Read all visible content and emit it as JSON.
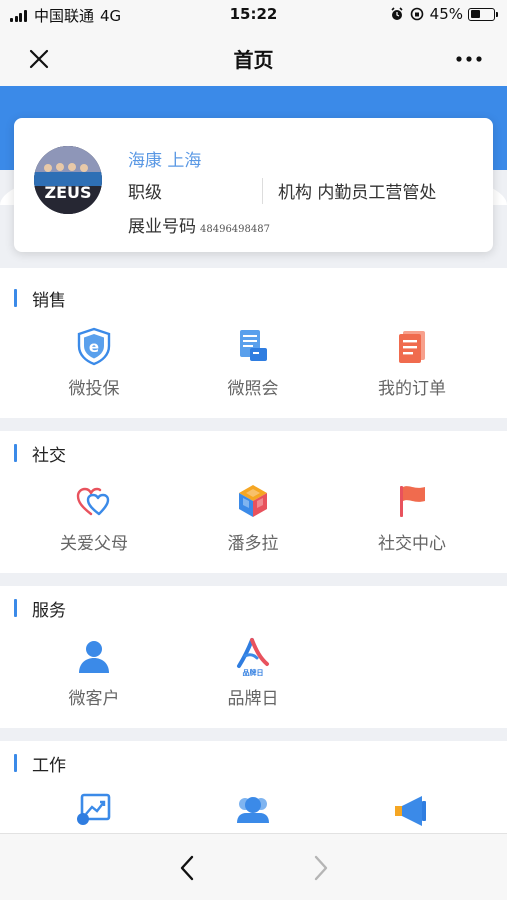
{
  "status_bar": {
    "carrier": "中国联通",
    "network": "4G",
    "time": "15:22",
    "battery": "45%",
    "battery_level": 0.45
  },
  "nav": {
    "title": "首页"
  },
  "profile": {
    "name_region": "海康 上海",
    "rank_label": "职级",
    "org": "机构 内勤员工营管处",
    "id_label": "展业号码",
    "id_number": "48496498487",
    "avatar_text": "ZEUS"
  },
  "sections": [
    {
      "title": "销售",
      "items": [
        {
          "label": "微投保",
          "icon": "shield-e-icon"
        },
        {
          "label": "微照会",
          "icon": "document-card-icon"
        },
        {
          "label": "我的订单",
          "icon": "order-list-icon"
        }
      ]
    },
    {
      "title": "社交",
      "items": [
        {
          "label": "关爱父母",
          "icon": "hearts-icon"
        },
        {
          "label": "潘多拉",
          "icon": "cube-icon"
        },
        {
          "label": "社交中心",
          "icon": "flag-icon"
        }
      ]
    },
    {
      "title": "服务",
      "items": [
        {
          "label": "微客户",
          "icon": "person-icon"
        },
        {
          "label": "品牌日",
          "icon": "brand-day-icon",
          "badge": "品牌日"
        }
      ]
    },
    {
      "title": "工作",
      "items": [
        {
          "label": "",
          "icon": "chart-image-icon"
        },
        {
          "label": "",
          "icon": "people-icon"
        },
        {
          "label": "",
          "icon": "megaphone-icon"
        }
      ]
    }
  ],
  "colors": {
    "accent": "#3b8ae8",
    "name_text": "#5a98e4",
    "order_red": "#f06b4e",
    "heart_red": "#e8525d"
  }
}
